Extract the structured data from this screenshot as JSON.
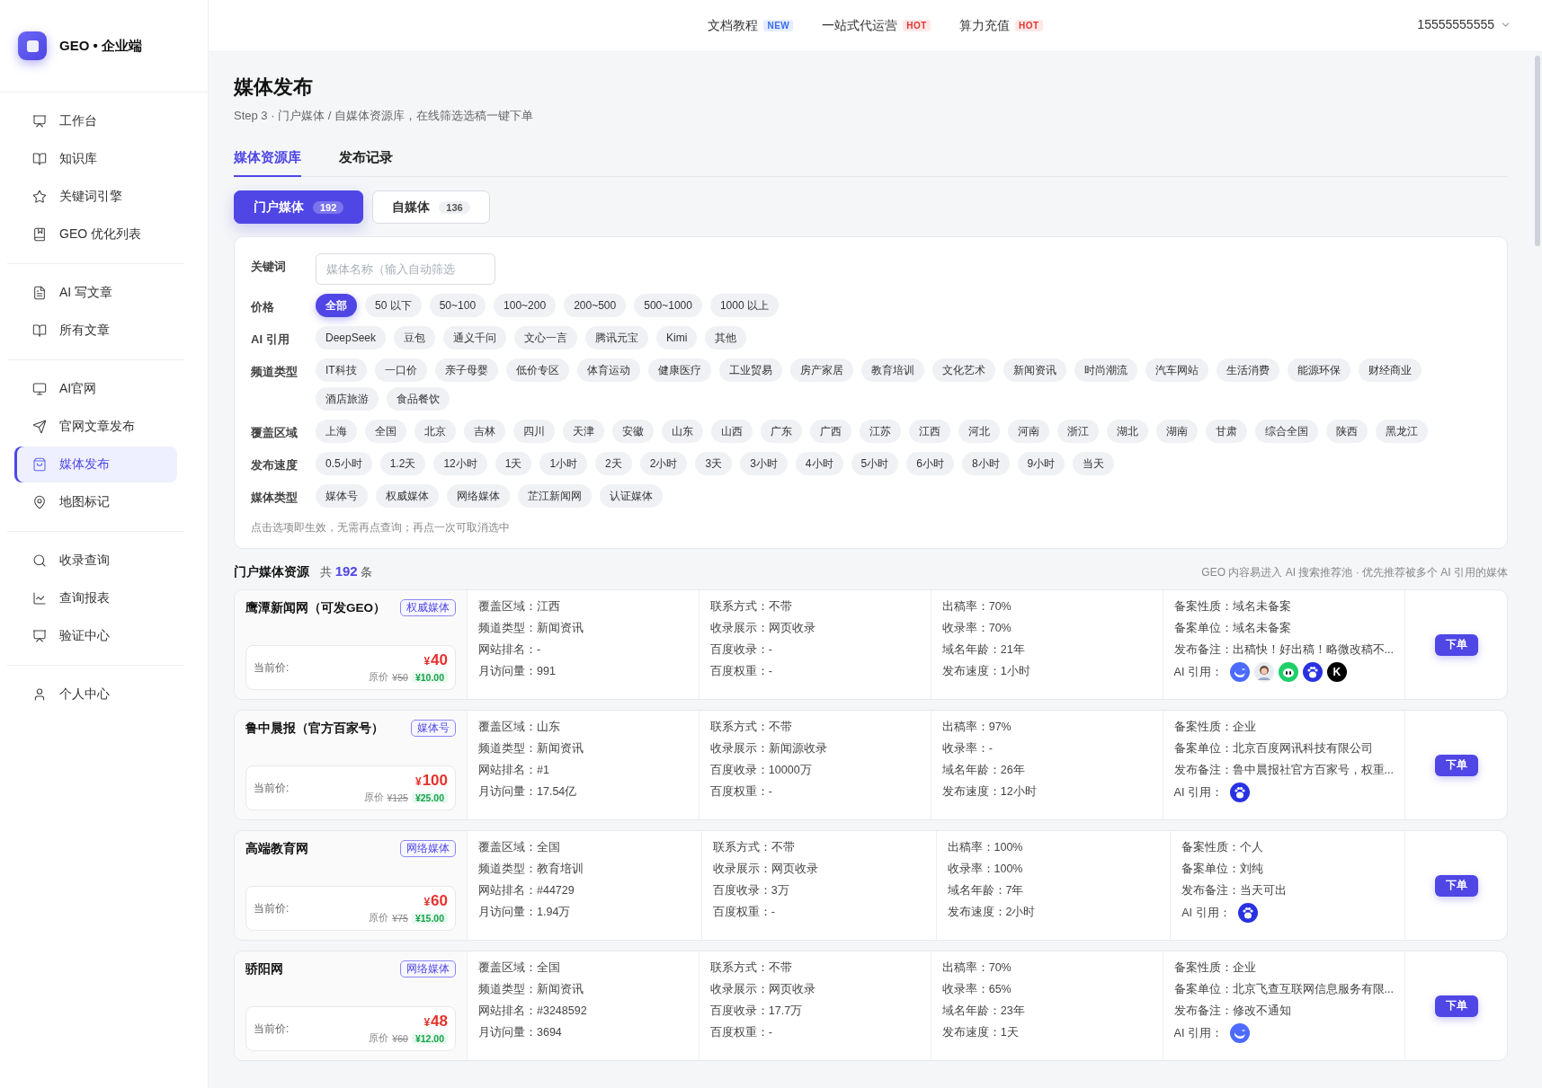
{
  "brand": {
    "name": "GEO • 企业端"
  },
  "sidebar": {
    "groups": [
      {
        "items": [
          {
            "label": "工作台",
            "kind": "board",
            "selected": false
          },
          {
            "label": "知识库",
            "kind": "book",
            "selected": false
          },
          {
            "label": "关键词引擎",
            "kind": "star",
            "selected": false
          },
          {
            "label": "GEO 优化列表",
            "kind": "bookmark",
            "selected": false
          }
        ]
      },
      {
        "items": [
          {
            "label": "AI 写文章",
            "kind": "file",
            "selected": false
          },
          {
            "label": "所有文章",
            "kind": "book",
            "selected": false
          }
        ]
      },
      {
        "items": [
          {
            "label": "AI官网",
            "kind": "monitor",
            "selected": false
          },
          {
            "label": "官网文章发布",
            "kind": "send",
            "selected": false
          },
          {
            "label": "媒体发布",
            "kind": "bag",
            "selected": true
          },
          {
            "label": "地图标记",
            "kind": "pin",
            "selected": false
          }
        ]
      },
      {
        "items": [
          {
            "label": "收录查询",
            "kind": "search",
            "selected": false
          },
          {
            "label": "查询报表",
            "kind": "chart",
            "selected": false
          },
          {
            "label": "验证中心",
            "kind": "board",
            "selected": false
          }
        ]
      },
      {
        "items": [
          {
            "label": "个人中心",
            "kind": "user",
            "selected": false
          }
        ]
      }
    ]
  },
  "top_nav": [
    {
      "label": "文档教程",
      "badge": "NEW",
      "kind": "new"
    },
    {
      "label": "一站式代运营",
      "badge": "HOT",
      "kind": "hot"
    },
    {
      "label": "算力充值",
      "badge": "HOT",
      "kind": "hot"
    }
  ],
  "account": "15555555555",
  "page": {
    "title": "媒体发布",
    "subtitle": "Step 3 · 门户媒体 / 自媒体资源库，在线筛选选稿一键下单"
  },
  "tabs": [
    {
      "label": "媒体资源库",
      "selected": true
    },
    {
      "label": "发布记录",
      "selected": false
    }
  ],
  "segments": [
    {
      "label": "门户媒体",
      "count": "192",
      "selected": true
    },
    {
      "label": "自媒体",
      "count": "136",
      "selected": false
    }
  ],
  "filters": [
    {
      "label": "关键词",
      "kind": "input",
      "placeholder": "媒体名称（输入自动筛选"
    },
    {
      "label": "价格",
      "kind": "chips",
      "chips": [
        {
          "label": "全部",
          "selected": true
        },
        {
          "label": "50 以下",
          "selected": false
        },
        {
          "label": "50~100",
          "selected": false
        },
        {
          "label": "100~200",
          "selected": false
        },
        {
          "label": "200~500",
          "selected": false
        },
        {
          "label": "500~1000",
          "selected": false
        },
        {
          "label": "1000 以上",
          "selected": false
        }
      ]
    },
    {
      "label": "AI 引用",
      "kind": "chips",
      "chips": [
        {
          "label": "DeepSeek",
          "selected": false
        },
        {
          "label": "豆包",
          "selected": false
        },
        {
          "label": "通义千问",
          "selected": false
        },
        {
          "label": "文心一言",
          "selected": false
        },
        {
          "label": "腾讯元宝",
          "selected": false
        },
        {
          "label": "Kimi",
          "selected": false
        },
        {
          "label": "其他",
          "selected": false
        }
      ]
    },
    {
      "label": "频道类型",
      "kind": "chips",
      "chips": [
        {
          "label": "IT科技",
          "selected": false
        },
        {
          "label": "一口价",
          "selected": false
        },
        {
          "label": "亲子母婴",
          "selected": false
        },
        {
          "label": "低价专区",
          "selected": false
        },
        {
          "label": "体育运动",
          "selected": false
        },
        {
          "label": "健康医疗",
          "selected": false
        },
        {
          "label": "工业贸易",
          "selected": false
        },
        {
          "label": "房产家居",
          "selected": false
        },
        {
          "label": "教育培训",
          "selected": false
        },
        {
          "label": "文化艺术",
          "selected": false
        },
        {
          "label": "新闻资讯",
          "selected": false
        },
        {
          "label": "时尚潮流",
          "selected": false
        },
        {
          "label": "汽车网站",
          "selected": false
        },
        {
          "label": "生活消费",
          "selected": false
        },
        {
          "label": "能源环保",
          "selected": false
        },
        {
          "label": "财经商业",
          "selected": false
        },
        {
          "label": "酒店旅游",
          "selected": false
        },
        {
          "label": "食品餐饮",
          "selected": false
        }
      ]
    },
    {
      "label": "覆盖区域",
      "kind": "chips",
      "chips": [
        {
          "label": "上海",
          "selected": false
        },
        {
          "label": "全国",
          "selected": false
        },
        {
          "label": "北京",
          "selected": false
        },
        {
          "label": "吉林",
          "selected": false
        },
        {
          "label": "四川",
          "selected": false
        },
        {
          "label": "天津",
          "selected": false
        },
        {
          "label": "安徽",
          "selected": false
        },
        {
          "label": "山东",
          "selected": false
        },
        {
          "label": "山西",
          "selected": false
        },
        {
          "label": "广东",
          "selected": false
        },
        {
          "label": "广西",
          "selected": false
        },
        {
          "label": "江苏",
          "selected": false
        },
        {
          "label": "江西",
          "selected": false
        },
        {
          "label": "河北",
          "selected": false
        },
        {
          "label": "河南",
          "selected": false
        },
        {
          "label": "浙江",
          "selected": false
        },
        {
          "label": "湖北",
          "selected": false
        },
        {
          "label": "湖南",
          "selected": false
        },
        {
          "label": "甘肃",
          "selected": false
        },
        {
          "label": "综合全国",
          "selected": false
        },
        {
          "label": "陕西",
          "selected": false
        },
        {
          "label": "黑龙江",
          "selected": false
        }
      ]
    },
    {
      "label": "发布速度",
      "kind": "chips",
      "chips": [
        {
          "label": "0.5小时",
          "selected": false
        },
        {
          "label": "1.2天",
          "selected": false
        },
        {
          "label": "12小时",
          "selected": false
        },
        {
          "label": "1天",
          "selected": false
        },
        {
          "label": "1小时",
          "selected": false
        },
        {
          "label": "2天",
          "selected": false
        },
        {
          "label": "2小时",
          "selected": false
        },
        {
          "label": "3天",
          "selected": false
        },
        {
          "label": "3小时",
          "selected": false
        },
        {
          "label": "4小时",
          "selected": false
        },
        {
          "label": "5小时",
          "selected": false
        },
        {
          "label": "6小时",
          "selected": false
        },
        {
          "label": "8小时",
          "selected": false
        },
        {
          "label": "9小时",
          "selected": false
        },
        {
          "label": "当天",
          "selected": false
        }
      ]
    },
    {
      "label": "媒体类型",
      "kind": "chips",
      "chips": [
        {
          "label": "媒体号",
          "selected": false
        },
        {
          "label": "权威媒体",
          "selected": false
        },
        {
          "label": "网络媒体",
          "selected": false
        },
        {
          "label": "芷江新闻网",
          "selected": false
        },
        {
          "label": "认证媒体",
          "selected": false
        }
      ]
    }
  ],
  "filter_hint": "点击选项即生效，无需再点查询；再点一次可取消选中",
  "list": {
    "title": "门户媒体资源",
    "count_prefix": "共",
    "count": "192",
    "count_suffix": "条",
    "note": "GEO 内容易进入 AI 搜索推荐池 · 优先推荐被多个 AI 引用的媒体"
  },
  "media": [
    {
      "name": "鹰潭新闻网（可发GEO）",
      "tag": "权威媒体",
      "price_label": "当前价:",
      "currency": "¥",
      "price": "40",
      "orig_label": "原价",
      "orig_price": "¥50",
      "discount": "¥10.00",
      "col_1": [
        "覆盖区域：江西",
        "频道类型：新闻资讯",
        "网站排名：-",
        "月访问量：991"
      ],
      "col_2": [
        "联系方式：不带",
        "收录展示：网页收录",
        "百度收录：-",
        "百度权重：-"
      ],
      "col_3": [
        "出稿率：70%",
        "收录率：70%",
        "域名年龄：21年",
        "发布速度：1小时"
      ],
      "col_4": [
        "备案性质：域名未备案",
        "备案单位：域名未备案",
        "发布备注：出稿快！好出稿！略微改稿不..."
      ],
      "ai_label": "AI 引用：",
      "ai": [
        {
          "kind": "whale"
        },
        {
          "kind": "avatar"
        },
        {
          "kind": "bean"
        },
        {
          "kind": "paw"
        },
        {
          "kind": "letter",
          "label": "K"
        }
      ],
      "action": "下单"
    },
    {
      "name": "鲁中晨报（官方百家号）",
      "tag": "媒体号",
      "price_label": "当前价:",
      "currency": "¥",
      "price": "100",
      "orig_label": "原价",
      "orig_price": "¥125",
      "discount": "¥25.00",
      "col_1": [
        "覆盖区域：山东",
        "频道类型：新闻资讯",
        "网站排名：#1",
        "月访问量：17.54亿"
      ],
      "col_2": [
        "联系方式：不带",
        "收录展示：新闻源收录",
        "百度收录：10000万",
        "百度权重：-"
      ],
      "col_3": [
        "出稿率：97%",
        "收录率：-",
        "域名年龄：26年",
        "发布速度：12小时"
      ],
      "col_4": [
        "备案性质：企业",
        "备案单位：北京百度网讯科技有限公司",
        "发布备注：鲁中晨报社官方百家号，权重..."
      ],
      "ai_label": "AI 引用：",
      "ai": [
        {
          "kind": "paw"
        }
      ],
      "action": "下单"
    },
    {
      "name": "高端教育网",
      "tag": "网络媒体",
      "price_label": "当前价:",
      "currency": "¥",
      "price": "60",
      "orig_label": "原价",
      "orig_price": "¥75",
      "discount": "¥15.00",
      "col_1": [
        "覆盖区域：全国",
        "频道类型：教育培训",
        "网站排名：#44729",
        "月访问量：1.94万"
      ],
      "col_2": [
        "联系方式：不带",
        "收录展示：网页收录",
        "百度收录：3万",
        "百度权重：-"
      ],
      "col_3": [
        "出稿率：100%",
        "收录率：100%",
        "域名年龄：7年",
        "发布速度：2小时"
      ],
      "col_4": [
        "备案性质：个人",
        "备案单位：刘纯",
        "发布备注：当天可出"
      ],
      "ai_label": "AI 引用：",
      "ai": [
        {
          "kind": "paw"
        }
      ],
      "action": "下单"
    },
    {
      "name": "骄阳网",
      "tag": "网络媒体",
      "price_label": "当前价:",
      "currency": "¥",
      "price": "48",
      "orig_label": "原价",
      "orig_price": "¥60",
      "discount": "¥12.00",
      "col_1": [
        "覆盖区域：全国",
        "频道类型：新闻资讯",
        "网站排名：#3248592",
        "月访问量：3694"
      ],
      "col_2": [
        "联系方式：不带",
        "收录展示：网页收录",
        "百度收录：17.7万",
        "百度权重：-"
      ],
      "col_3": [
        "出稿率：70%",
        "收录率：65%",
        "域名年龄：23年",
        "发布速度：1天"
      ],
      "col_4": [
        "备案性质：企业",
        "备案单位：北京飞查互联网信息服务有限...",
        "发布备注：修改不通知"
      ],
      "ai_label": "AI 引用：",
      "ai": [
        {
          "kind": "whale"
        }
      ],
      "action": "下单"
    }
  ]
}
